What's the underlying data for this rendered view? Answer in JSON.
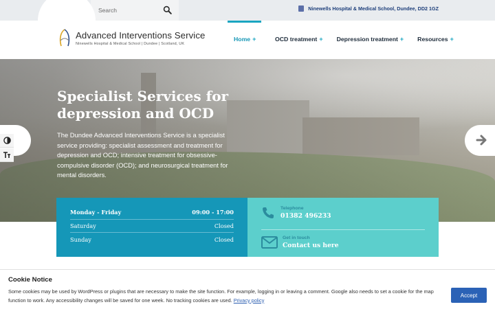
{
  "topbar": {
    "search_placeholder": "Search",
    "address": "Ninewells Hospital & Medical School, Dundee, DD2 1GZ"
  },
  "header": {
    "logo_title": "Advanced Interventions Service",
    "logo_subtitle": "Ninewells Hospital & Medical School | Dundee | Scotland, UK"
  },
  "nav": {
    "items": [
      {
        "label": "Home",
        "plus": "+"
      },
      {
        "label": "OCD treatment",
        "plus": "+"
      },
      {
        "label": "Depression treatment",
        "plus": "+"
      },
      {
        "label": "Resources",
        "plus": "+"
      }
    ]
  },
  "hero": {
    "title": "Specialist Services for depression and OCD",
    "text": "The Dundee Advanced Interventions Service is a specialist service providing: specialist assessment and treatment for depression and OCD; intensive treatment for obsessive-compulsive disorder (OCD); and neurosurgical treatment for mental disorders."
  },
  "hours": {
    "rows": [
      {
        "day": "Monday - Friday",
        "time": "09:00 - 17:00"
      },
      {
        "day": "Saturday",
        "time": "Closed"
      },
      {
        "day": "Sunday",
        "time": "Closed"
      }
    ]
  },
  "contact": {
    "phone_label": "Telephone",
    "phone_value": "01382 496233",
    "email_label": "Get in touch",
    "email_value": "Contact us here"
  },
  "cookie": {
    "title": "Cookie Notice",
    "text": "Some cookies may be used by WordPress or plugins that are necessary to make the site function. For example, logging in or leaving a comment. Google also needs to set a cookie for the map function to work. Any accessibility changes will be saved for one week. No tracking cookies are used.",
    "link": "Privacy policy",
    "accept": "Accept"
  },
  "icons": {
    "search": "search-icon",
    "building": "building-icon",
    "phone": "phone-icon",
    "mail": "mail-icon",
    "contrast": "contrast-icon",
    "text_size": "text-size-icon",
    "arrow_right": "arrow-right-icon"
  },
  "colors": {
    "accent": "#1aa5c1",
    "hours_bg": "#1597b8",
    "contact_bg": "#5ccfcc",
    "accept_bg": "#2b62b6"
  }
}
